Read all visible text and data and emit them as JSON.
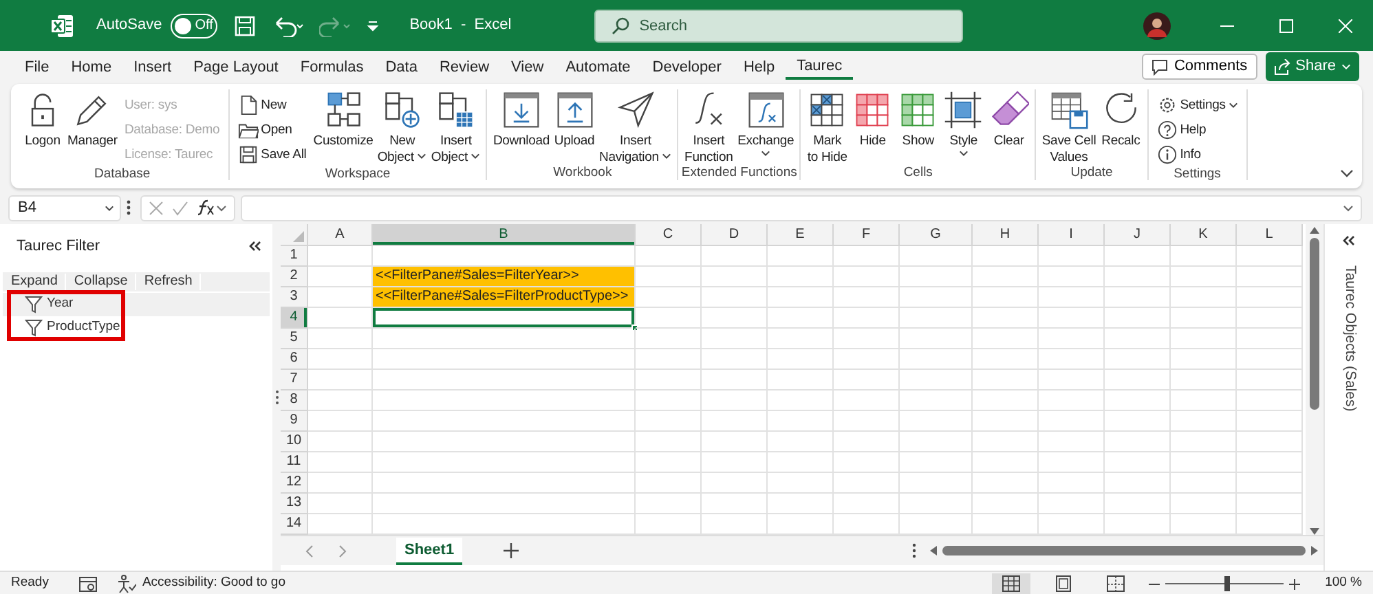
{
  "title_bar": {
    "autosave_label": "AutoSave",
    "autosave_toggle": {
      "label": "Off",
      "on": false
    },
    "redo_disabled": true,
    "title": "Book1  -  Excel",
    "search": {
      "placeholder": "Search"
    }
  },
  "menu_tabs": [
    {
      "label": "File",
      "selected": false
    },
    {
      "label": "Home",
      "selected": false
    },
    {
      "label": "Insert",
      "selected": false
    },
    {
      "label": "Page Layout",
      "selected": false
    },
    {
      "label": "Formulas",
      "selected": false
    },
    {
      "label": "Data",
      "selected": false
    },
    {
      "label": "Review",
      "selected": false
    },
    {
      "label": "View",
      "selected": false
    },
    {
      "label": "Automate",
      "selected": false
    },
    {
      "label": "Developer",
      "selected": false
    },
    {
      "label": "Help",
      "selected": false
    },
    {
      "label": "Taurec",
      "selected": true
    }
  ],
  "comments_button": "Comments",
  "share_button": "Share",
  "ribbon": {
    "groups": [
      {
        "label": "Database",
        "items": [
          {
            "kind": "large",
            "lines": [
              "Logon"
            ]
          },
          {
            "kind": "large",
            "lines": [
              "Manager"
            ]
          },
          {
            "kind": "stack",
            "entries": [
              {
                "label": "User: sys",
                "disabled": true
              },
              {
                "label": "Database: Demo",
                "disabled": true
              },
              {
                "label": "License: Taurec",
                "disabled": true
              }
            ]
          }
        ]
      },
      {
        "label": "Workspace",
        "items": [
          {
            "kind": "stack",
            "entries": [
              {
                "label": "New",
                "disabled": false
              },
              {
                "label": "Open",
                "disabled": false
              },
              {
                "label": "Save All",
                "disabled": false
              }
            ]
          },
          {
            "kind": "large",
            "lines": [
              "Customize"
            ]
          },
          {
            "kind": "large",
            "lines": [
              "New",
              "Object"
            ],
            "dropdown": true
          },
          {
            "kind": "large",
            "lines": [
              "Insert",
              "Object"
            ],
            "dropdown": true
          }
        ]
      },
      {
        "label": "Workbook",
        "items": [
          {
            "kind": "large",
            "lines": [
              "Download"
            ]
          },
          {
            "kind": "large",
            "lines": [
              "Upload"
            ]
          },
          {
            "kind": "large",
            "lines": [
              "Insert",
              "Navigation"
            ],
            "dropdown": true
          }
        ]
      },
      {
        "label": "Extended Functions",
        "items": [
          {
            "kind": "large",
            "lines": [
              "Insert",
              "Function"
            ]
          },
          {
            "kind": "large",
            "lines": [
              "Exchange"
            ],
            "dropdown": true
          }
        ]
      },
      {
        "label": "Cells",
        "items": [
          {
            "kind": "large",
            "lines": [
              "Mark",
              "to Hide"
            ]
          },
          {
            "kind": "large",
            "lines": [
              "Hide"
            ]
          },
          {
            "kind": "large",
            "lines": [
              "Show"
            ]
          },
          {
            "kind": "large",
            "lines": [
              "Style"
            ],
            "dropdown": true
          },
          {
            "kind": "large",
            "lines": [
              "Clear"
            ]
          }
        ]
      },
      {
        "label": "Update",
        "items": [
          {
            "kind": "large",
            "lines": [
              "Save Cell",
              "Values"
            ]
          },
          {
            "kind": "large",
            "lines": [
              "Recalc"
            ]
          }
        ]
      },
      {
        "label": "Settings",
        "items": [
          {
            "kind": "stack",
            "entries": [
              {
                "label": "Settings",
                "disabled": false,
                "dropdown": true
              },
              {
                "label": "Help",
                "disabled": false
              },
              {
                "label": "Info",
                "disabled": false
              }
            ]
          }
        ]
      }
    ]
  },
  "formula_bar": {
    "name_box": "B4"
  },
  "filter_pane": {
    "title": "Taurec Filter",
    "toolbar": [
      "Expand",
      "Collapse",
      "Refresh"
    ],
    "items": [
      {
        "label": "Year"
      },
      {
        "label": "ProductType"
      }
    ],
    "highlighted": true
  },
  "sheet": {
    "columns": [
      {
        "label": "A",
        "selected": false
      },
      {
        "label": "B",
        "selected": true
      },
      {
        "label": "C",
        "selected": false
      },
      {
        "label": "D",
        "selected": false
      },
      {
        "label": "E",
        "selected": false
      },
      {
        "label": "F",
        "selected": false
      },
      {
        "label": "G",
        "selected": false
      },
      {
        "label": "H",
        "selected": false
      },
      {
        "label": "I",
        "selected": false
      },
      {
        "label": "J",
        "selected": false
      },
      {
        "label": "K",
        "selected": false
      },
      {
        "label": "L",
        "selected": false
      }
    ],
    "rows": [
      {
        "header": "1",
        "selected": false
      },
      {
        "header": "2",
        "selected": false,
        "cell_b": "<<FilterPane#Sales=FilterYear>>",
        "highlighted": true
      },
      {
        "header": "3",
        "selected": false,
        "cell_b": "<<FilterPane#Sales=FilterProductType>>",
        "highlighted": true
      },
      {
        "header": "4",
        "selected": true
      },
      {
        "header": "5",
        "selected": false
      },
      {
        "header": "6",
        "selected": false
      },
      {
        "header": "7",
        "selected": false
      },
      {
        "header": "8",
        "selected": false
      },
      {
        "header": "9",
        "selected": false
      },
      {
        "header": "10",
        "selected": false
      },
      {
        "header": "11",
        "selected": false
      },
      {
        "header": "12",
        "selected": false
      },
      {
        "header": "13",
        "selected": false
      },
      {
        "header": "14",
        "selected": false
      }
    ]
  },
  "objects_pane": {
    "title": "Taurec Objects (Sales)"
  },
  "sheet_tabs": [
    {
      "label": "Sheet1",
      "selected": true
    }
  ],
  "status_bar": {
    "ready": "Ready",
    "accessibility": "Accessibility: Good to go",
    "views": [
      {
        "selected": true
      },
      {
        "selected": false
      },
      {
        "selected": false
      }
    ],
    "zoom": {
      "level": 0.52
    },
    "zoom_label": "100 %"
  }
}
